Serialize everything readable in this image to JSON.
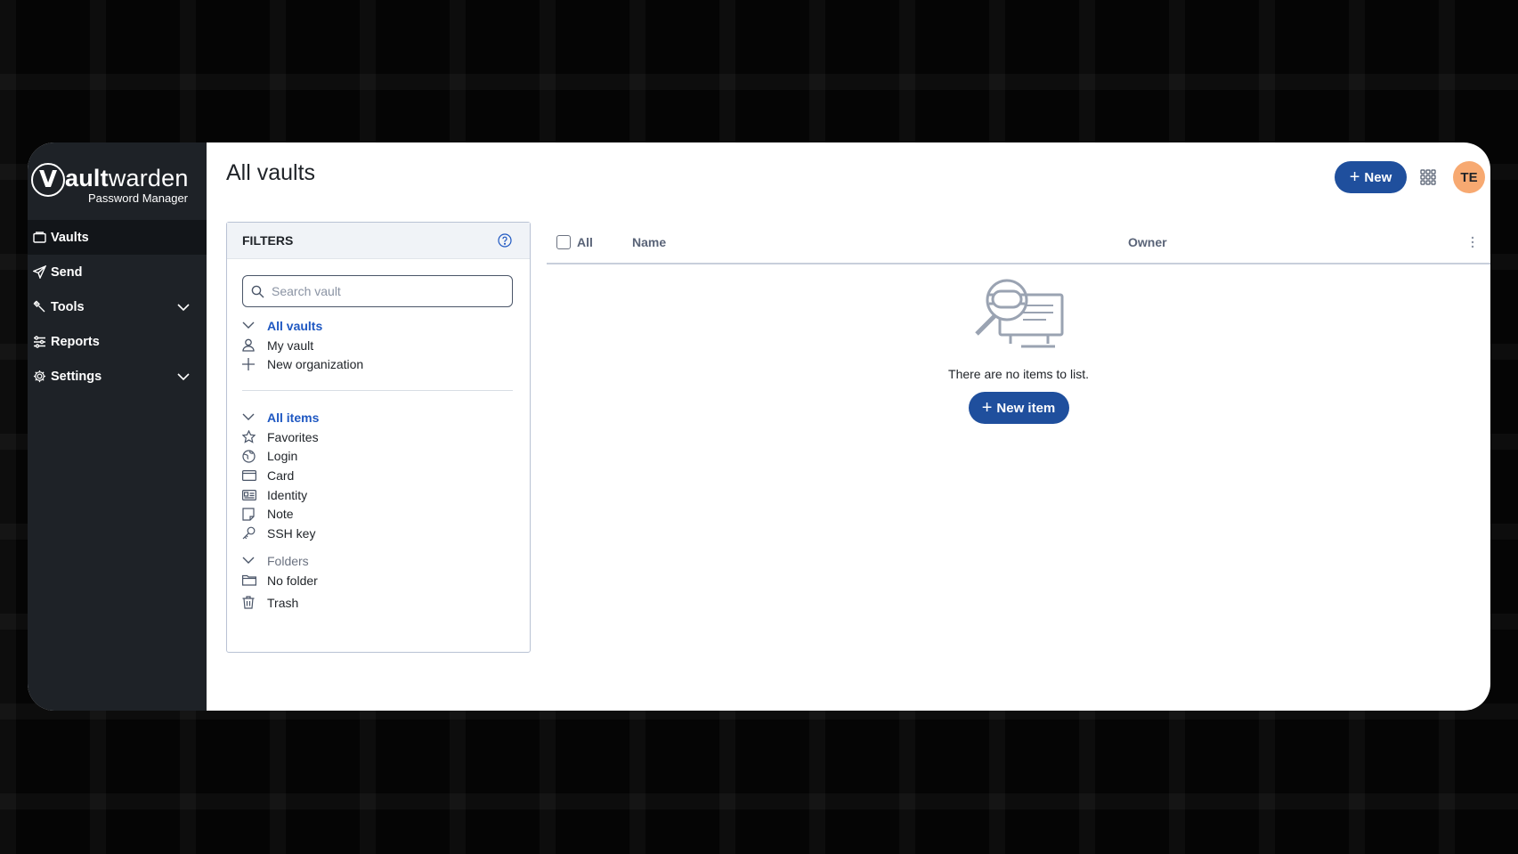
{
  "sidebar": {
    "logo_v": "V",
    "logo_bold": "ault",
    "logo_rest": "warden",
    "logo_sub": "Password Manager",
    "items": [
      {
        "label": "Vaults",
        "icon": "vault-icon"
      },
      {
        "label": "Send",
        "icon": "send-icon"
      },
      {
        "label": "Tools",
        "icon": "wrench-icon"
      },
      {
        "label": "Reports",
        "icon": "sliders-icon"
      },
      {
        "label": "Settings",
        "icon": "gear-icon"
      }
    ]
  },
  "header": {
    "title": "All vaults",
    "new_label": "New",
    "avatar_initials": "TE"
  },
  "filters": {
    "title": "FILTERS",
    "search_placeholder": "Search vault",
    "vaults": {
      "all": "All vaults",
      "my_vault": "My vault",
      "new_org": "New organization"
    },
    "types": {
      "all": "All items",
      "favorites": "Favorites",
      "login": "Login",
      "card": "Card",
      "identity": "Identity",
      "note": "Note",
      "ssh": "SSH key"
    },
    "folders": {
      "head": "Folders",
      "no_folder": "No folder"
    },
    "trash": "Trash"
  },
  "table": {
    "col_all": "All",
    "col_name": "Name",
    "col_owner": "Owner"
  },
  "empty": {
    "message": "There are no items to list.",
    "new_item_label": "New item"
  },
  "colors": {
    "primary": "#1f4f9d",
    "link": "#1f58c2",
    "sidebar_bg": "#1e2227",
    "avatar": "#f7a971"
  }
}
